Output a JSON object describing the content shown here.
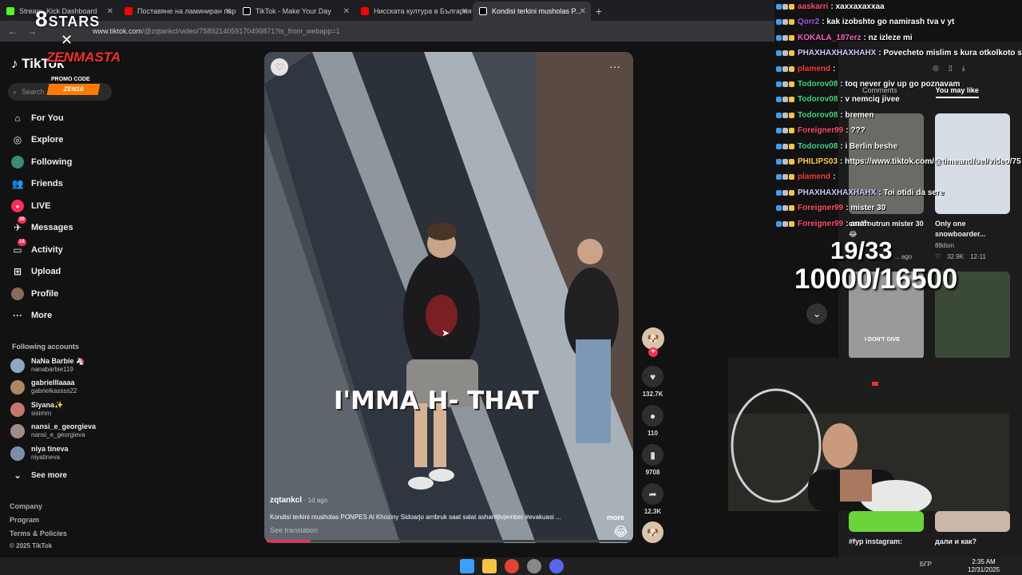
{
  "browser": {
    "tabs": [
      {
        "title": "Stream: Kick Dashboard",
        "favicon_color": "#53fc18",
        "active": false
      },
      {
        "title": "Поставяне на ламиниран пар...",
        "favicon_color": "#ff0000",
        "active": false
      },
      {
        "title": "TikTok - Make Your Day",
        "favicon_color": "#ffffff",
        "active": false
      },
      {
        "title": "Нисската култура в България -",
        "favicon_color": "#ff0000",
        "active": false
      },
      {
        "title": "Kondisi terkini musholas P...",
        "favicon_color": "#ffffff",
        "active": true
      }
    ],
    "url_host": "www.tiktok.com",
    "url_path": "/@zqtankcl/video/7589214059170499871?is_from_webapp=1"
  },
  "overlay": {
    "stars": "STARS",
    "brand": "ZENMASTA",
    "promo_label": "PROMO CODE",
    "promo_code": "ZEN10"
  },
  "sidebar": {
    "logo": "TikTok",
    "search_placeholder": "Search",
    "nav": [
      {
        "label": "For You",
        "icon": "home-icon"
      },
      {
        "label": "Explore",
        "icon": "compass-icon"
      },
      {
        "label": "Following",
        "icon": "following-icon"
      },
      {
        "label": "Friends",
        "icon": "friends-icon"
      },
      {
        "label": "LIVE",
        "icon": "live-icon"
      },
      {
        "label": "Messages",
        "icon": "messages-icon",
        "badge": "39"
      },
      {
        "label": "Activity",
        "icon": "activity-icon",
        "badge": "14"
      },
      {
        "label": "Upload",
        "icon": "upload-icon"
      },
      {
        "label": "Profile",
        "icon": "profile-icon"
      },
      {
        "label": "More",
        "icon": "more-icon"
      }
    ],
    "following_header": "Following accounts",
    "accounts": [
      {
        "name": "NaNa Barbie 🦄",
        "handle": "nanabarbie119"
      },
      {
        "name": "gabrielllaaaa",
        "handle": "gabrielkassss22"
      },
      {
        "name": "Siyana✨",
        "handle": "sisimrn"
      },
      {
        "name": "nansi_e_georgieva",
        "handle": "nansi_e_georgieva"
      },
      {
        "name": "niya tineva",
        "handle": "niyatineva"
      }
    ],
    "see_more": "See more",
    "footer": [
      "Company",
      "Program",
      "Terms & Policies"
    ],
    "copyright": "© 2025 TikTok"
  },
  "video": {
    "caption": "I'MMA H- THAT",
    "author": "zqtankcl",
    "ago": "· 1d ago",
    "description": "Kondisi terkini musholas PONPES Al Khoziny Sidoarjo ambruk saat salat ashar#jtvjember #evakuasi ...",
    "more": "more",
    "see_translation": "See translation",
    "progress": 0.12,
    "likes": "132.7K",
    "comments": "110",
    "saves": "9708",
    "shares": "12.3K"
  },
  "chat": [
    {
      "user": "aaskarri",
      "color": "#ff4d6d",
      "text": "xaxxaxaxxaa"
    },
    {
      "user": "Qorr2",
      "color": "#a855f7",
      "text": "kak izobshto go namirash tva v yt"
    },
    {
      "user": "KOKALA_187erz",
      "color": "#ff5ec4",
      "text": "nz izleze mi"
    },
    {
      "user": "PHAXHAXHAXHAHX",
      "color": "#c9c9ff",
      "text": "Povecheto mislim s kura otkolkoto sus"
    },
    {
      "user": "plamend",
      "color": "#ff3b3b",
      "text": ""
    },
    {
      "user": "Todorov08",
      "color": "#3ddc84",
      "text": "toq never giv up go poznavam"
    },
    {
      "user": "Todorov08",
      "color": "#3ddc84",
      "text": "v nemciq jivee"
    },
    {
      "user": "Todorov08",
      "color": "#3ddc84",
      "text": "bremen"
    },
    {
      "user": "Foreigner99",
      "color": "#ff4d6d",
      "text": "???"
    },
    {
      "user": "Todorov08",
      "color": "#3ddc84",
      "text": "i Berlin beshe"
    },
    {
      "user": "PHILIPS03",
      "color": "#ffd23f",
      "text": "https://www.tiktok.com/@timeandfuel/video/75"
    },
    {
      "user": "plamend",
      "color": "#ff3b3b",
      "text": ""
    },
    {
      "user": "PHAXHAXHAXHAHX",
      "color": "#c9c9ff",
      "text": "Toi otidi da sere"
    },
    {
      "user": "Foreigner99",
      "color": "#ff4d6d",
      "text": "mister 30"
    },
    {
      "user": "Foreigner99",
      "color": "#ff4d6d",
      "text": "anah"
    }
  ],
  "right_panel": {
    "tab_comments": "Comments",
    "tab_you_may_like": "You may like",
    "items": [
      {
        "caption": "can't outrun mister 30 😂",
        "meta": "... ago"
      },
      {
        "caption": "Only one snowboarder...",
        "author": "88dsm",
        "likes": "32.9K",
        "date": "12-11"
      },
      {
        "caption": "#fyp instagram:",
        "meta": ""
      },
      {
        "caption": "дали и как?",
        "meta": ""
      }
    ],
    "overlay_thumb_text": "I DON'T GIVE"
  },
  "stream_counters": {
    "line1": "19/33",
    "line2": "10000/16500"
  },
  "taskbar": {
    "lang": "БГР",
    "time": "2:35 AM",
    "date": "12/31/2025"
  }
}
